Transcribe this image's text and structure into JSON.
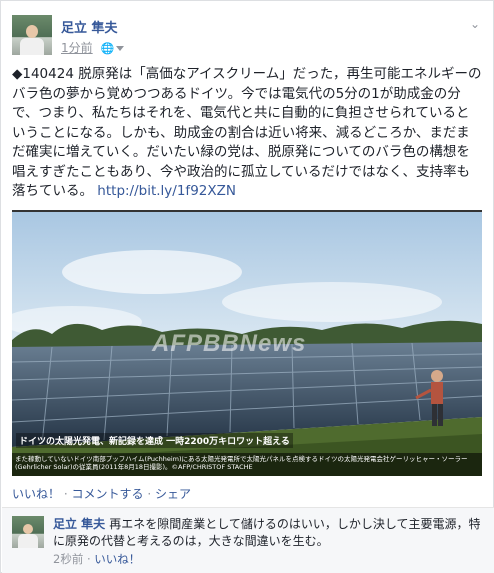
{
  "post": {
    "author": "足立 隼夫",
    "time": "1分前",
    "text": "◆140424 脱原発は「高価なアイスクリーム」だった，再生可能エネルギーのバラ色の夢から覚めつつあるドイツ。今では電気代の5分の1が助成金の分で、つまり、私たちはそれを、電気代と共に自動的に負担させられているということになる。しかも、助成金の割合は近い将来、減るどころか、まだまだ確実に増えていく。だいたい緑の党は、脱原発についてのバラ色の構想を唱えすぎたこともあり、今や政治的に孤立しているだけではなく、支持率も落ちている。",
    "link": "http://bit.ly/1f92XZN"
  },
  "photo": {
    "watermark": "AFPBBNews",
    "headline": "ドイツの太陽光発電、新記録を達成 一時2200万キロワット超える",
    "caption": "また稼動していないドイツ南部プッフハイム(Puchheim)にある太陽光発電所で太陽光パネルを点検するドイツの太陽光発電会社ゲーリッヒャー・ソーラー(Gehrlicher Solar)の従業員(2011年8月18日撮影)。©AFP/CHRISTOF STACHE"
  },
  "actions": {
    "like": "いいね！",
    "comment": "コメントする",
    "share": "シェア",
    "separator": "·"
  },
  "comment": {
    "author": "足立 隼夫",
    "text": "再エネを隙間産業として儲けるのはいい，しかし決して主要電源，特に原発の代替と考えるのは，大きな間違いを生む。",
    "time": "2秒前",
    "like": "いいね！"
  },
  "colors": {
    "link": "#365899",
    "text": "#1d2129",
    "meta": "#90949c"
  },
  "icons": [
    "globe-icon",
    "caret-down-icon",
    "chevron-down-icon"
  ]
}
